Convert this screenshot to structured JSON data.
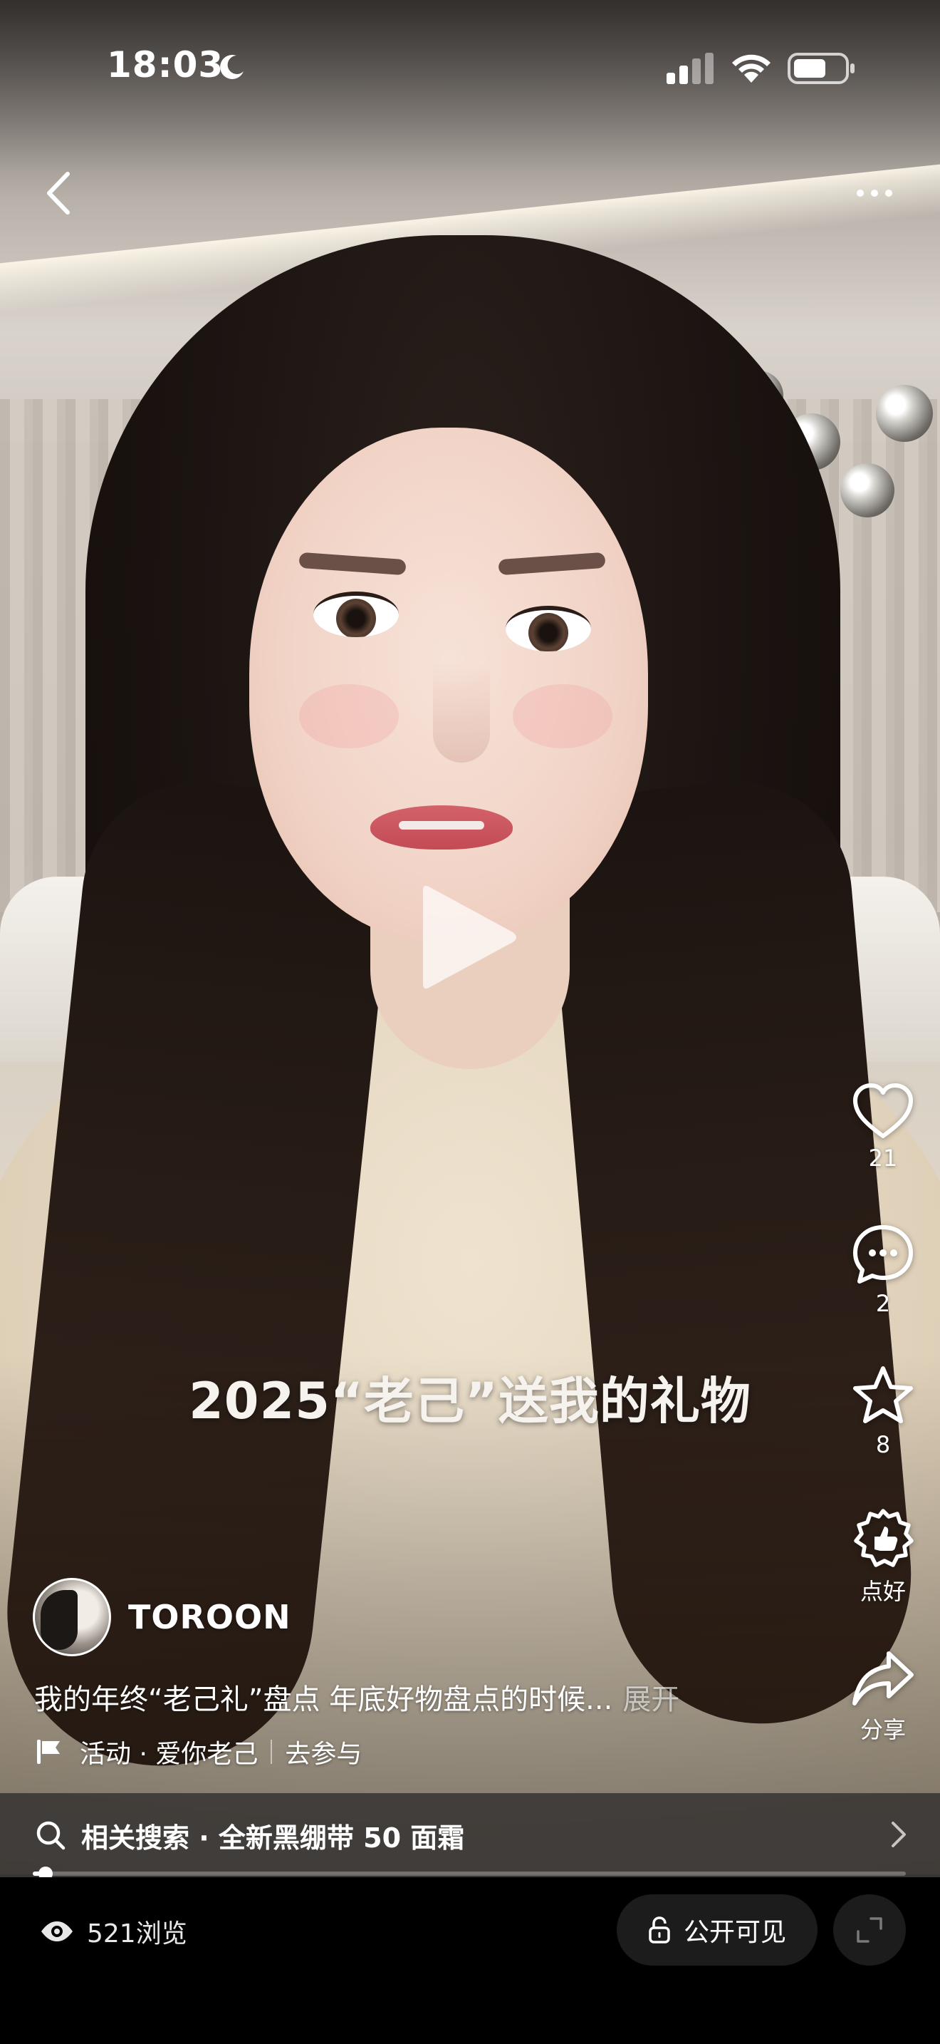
{
  "status_bar": {
    "time": "18:03",
    "icons": [
      "moon-icon",
      "signal-icon",
      "wifi-icon",
      "battery-icon"
    ]
  },
  "top_nav": {
    "back_icon": "chevron-left-icon",
    "more_icon": "more-dots-icon"
  },
  "video": {
    "caption": "2025“老己”送我的礼物",
    "state": "paused",
    "progress": 0.01
  },
  "actions": {
    "like": {
      "icon": "heart-icon",
      "count": "21"
    },
    "comment": {
      "icon": "comment-icon",
      "count": "2"
    },
    "favorite": {
      "icon": "star-icon",
      "count": "8"
    },
    "nice": {
      "icon": "thumb-badge-icon",
      "label": "点好"
    },
    "share": {
      "icon": "share-icon",
      "label": "分享"
    }
  },
  "author": {
    "name": "TOROON"
  },
  "post": {
    "description": "我的年终“老己礼”盘点 年底好物盘点的时候...",
    "expand_label": "展开",
    "activity_text": "活动 · 爱你老己",
    "join_label": "去参与"
  },
  "related_search": {
    "text": "相关搜索 · 全新黑绷带 50 面霜"
  },
  "bottom_bar": {
    "views": "521浏览",
    "visibility_label": "公开可见"
  },
  "colors": {
    "background": "#000000",
    "caption_text": "#f6f2ee",
    "related_bar": "#3c3836",
    "pill": "#1c1c1c"
  }
}
